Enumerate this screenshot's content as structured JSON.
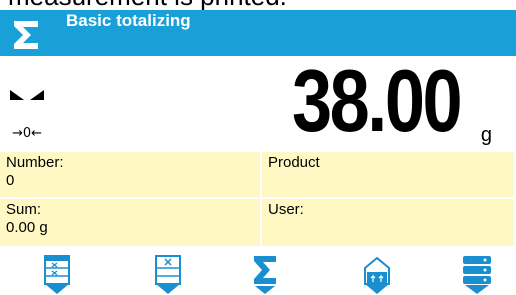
{
  "caption": "measurement is printed.",
  "header": {
    "title": "Basic totalizing",
    "icon": "sigma-icon"
  },
  "reading": {
    "value": "38.00",
    "unit": "g",
    "zero_symbol": "→0←"
  },
  "info": {
    "number_label": "Number:",
    "number_value": "0",
    "product_label": "Product",
    "sum_label": "Sum:",
    "sum_value": "0.00 g",
    "user_label": "User:"
  },
  "toolbar": {
    "buttons": [
      "accept-icon",
      "cancel-icon",
      "sigma-icon",
      "tare-icon",
      "database-icon"
    ]
  },
  "colors": {
    "header_bg": "#1aa0d8",
    "info_bg": "#fff8c4",
    "icon_blue": "#1a8fd0"
  }
}
